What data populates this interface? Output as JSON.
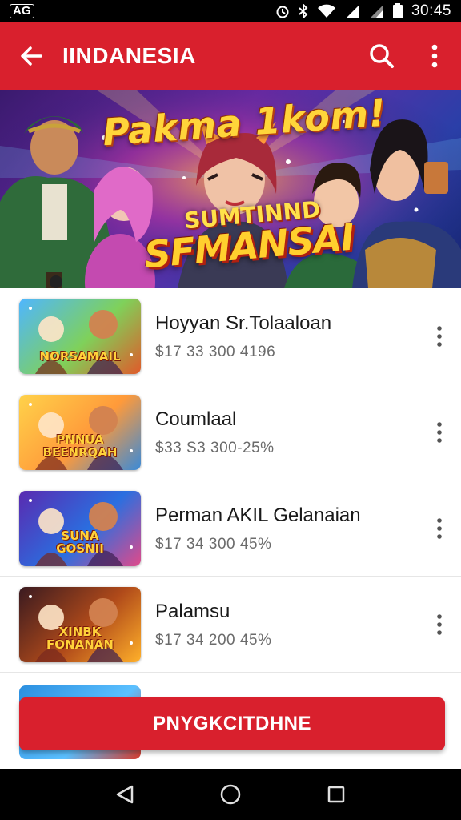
{
  "status_bar": {
    "left_label": "AG",
    "time": "30:45"
  },
  "app_bar": {
    "title": "IINDANESIA"
  },
  "banner": {
    "title": "Pakma 1kom!",
    "subtitle_line1": "SUMTINND",
    "subtitle_line2": "SFMANSAI"
  },
  "games": [
    {
      "title": "Hoyyan Sr.Tolaaloan",
      "subtitle": "$17 33  300  4196",
      "thumb_label": "NORSAMAIL",
      "colors": [
        "#4fb6ff",
        "#7fd15a",
        "#e05a2a"
      ]
    },
    {
      "title": "Coumlaal",
      "subtitle": "$33 S3  300-25%",
      "thumb_label": "PNNUA\nBEENRQAH",
      "colors": [
        "#ffd24a",
        "#ff9a3a",
        "#3a8ad8"
      ]
    },
    {
      "title": "Perman AKIL Gelanaian",
      "subtitle": "$17 34  300  45%",
      "thumb_label": "SUNA\nGOSNII",
      "colors": [
        "#5a2ab0",
        "#2a6fe0",
        "#e04a8a"
      ]
    },
    {
      "title": "Palamsu",
      "subtitle": "$17 34  200  45%",
      "thumb_label": "XINBK\nFONANAN",
      "colors": [
        "#3a1a20",
        "#b04a1a",
        "#ffb02a"
      ]
    }
  ],
  "cta": {
    "label": "PNYGKCITDHNE"
  },
  "colors": {
    "primary": "#d9202d"
  }
}
